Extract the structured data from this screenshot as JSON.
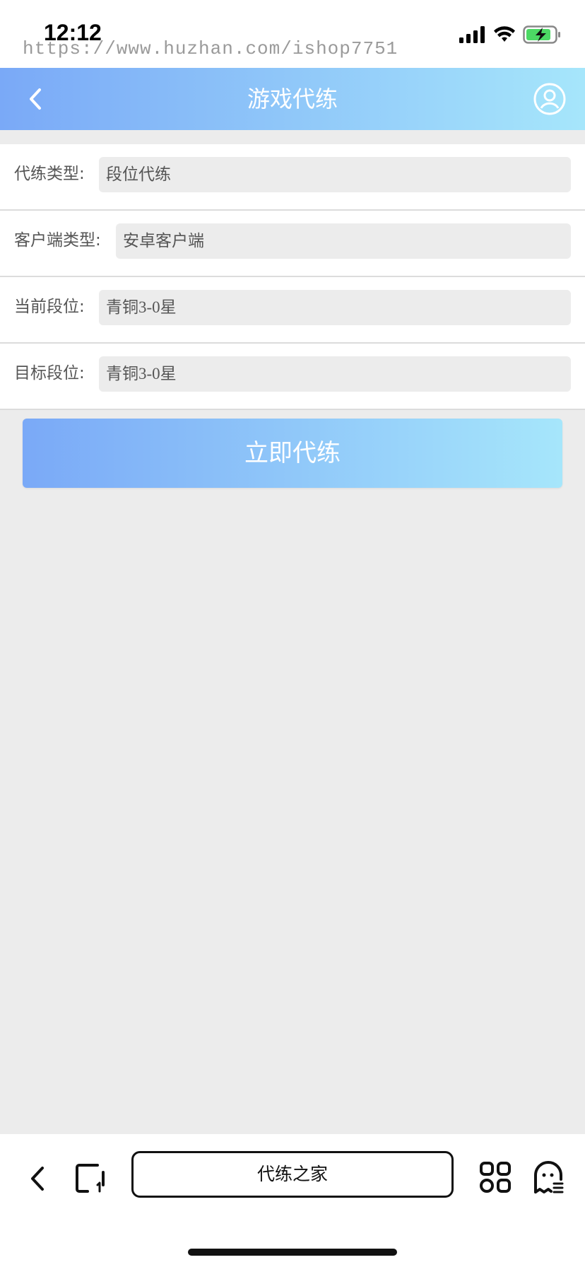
{
  "status_bar": {
    "time": "12:12",
    "watermark": "https://www.huzhan.com/ishop7751"
  },
  "header": {
    "title": "游戏代练",
    "back_icon": "chevron-left-icon",
    "user_icon": "user-circle-icon",
    "gradient_start": "#7aa9f7",
    "gradient_end": "#a6e6fb"
  },
  "form": {
    "rows": [
      {
        "label": "代练类型:",
        "value": "段位代练"
      },
      {
        "label": "客户端类型:",
        "value": "安卓客户端"
      },
      {
        "label": "当前段位:",
        "value": "青铜3-0星"
      },
      {
        "label": "目标段位:",
        "value": "青铜3-0星"
      }
    ]
  },
  "submit_label": "立即代练",
  "browser_bar": {
    "url_label": "代练之家",
    "icons": [
      "chevron-left-icon",
      "tabs-icon",
      "grid-icon",
      "ghost-icon"
    ]
  }
}
